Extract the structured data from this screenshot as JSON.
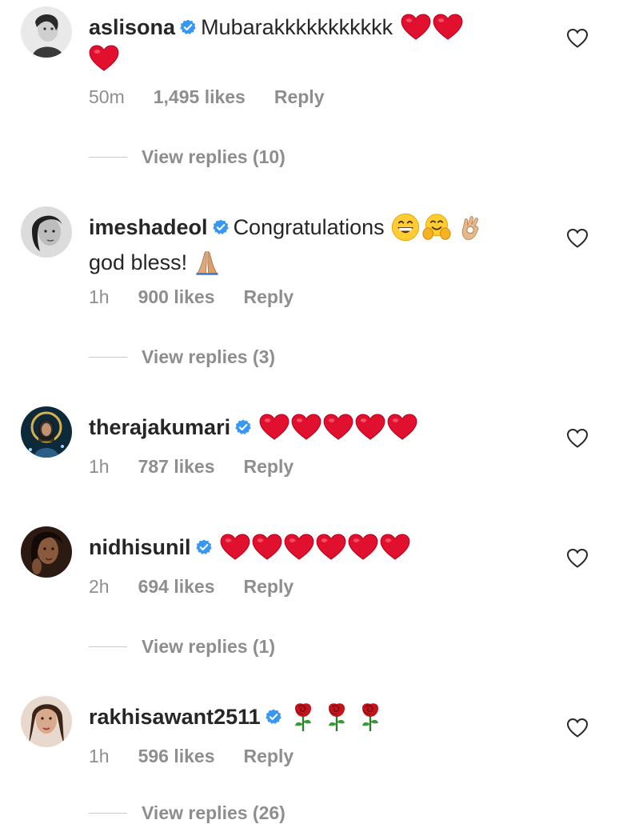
{
  "comments": [
    {
      "username": "aslisona",
      "verified": true,
      "text": "Mubarakkkkkkkkkkk",
      "emojis": [
        "red-heart",
        "red-heart",
        "red-heart"
      ],
      "time": "50m",
      "likes": "1,495 likes",
      "reply": "Reply",
      "view_replies": "View replies (10)"
    },
    {
      "username": "imeshadeol",
      "verified": true,
      "text": "Congratulations",
      "emojis": [
        "grinning-face",
        "hugging-face",
        "ok-hand"
      ],
      "text2": "god bless!",
      "emojis2": [
        "folded-hands"
      ],
      "time": "1h",
      "likes": "900 likes",
      "reply": "Reply",
      "view_replies": "View replies (3)"
    },
    {
      "username": "therajakumari",
      "verified": true,
      "text": "",
      "emojis": [
        "red-heart",
        "red-heart",
        "red-heart",
        "red-heart",
        "red-heart"
      ],
      "time": "1h",
      "likes": "787 likes",
      "reply": "Reply"
    },
    {
      "username": "nidhisunil",
      "verified": true,
      "text": "",
      "emojis": [
        "red-heart",
        "red-heart",
        "red-heart",
        "red-heart",
        "red-heart",
        "red-heart"
      ],
      "time": "2h",
      "likes": "694 likes",
      "reply": "Reply",
      "view_replies": "View replies (1)"
    },
    {
      "username": "rakhisawant2511",
      "verified": true,
      "text": "",
      "emojis": [
        "rose",
        "rose",
        "rose"
      ],
      "time": "1h",
      "likes": "596 likes",
      "reply": "Reply",
      "view_replies": "View replies (26)"
    }
  ],
  "colors": {
    "text": "#262626",
    "secondary": "#8e8e8e",
    "verified": "#3897f0",
    "heart_emoji": "#e0102e"
  }
}
